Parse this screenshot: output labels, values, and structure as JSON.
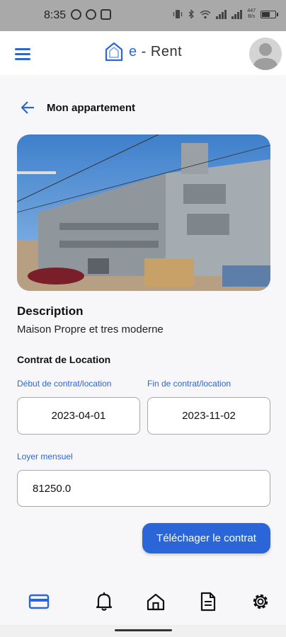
{
  "status": {
    "time": "8:35",
    "net_speed_top": "447",
    "net_speed_bottom": "B/s",
    "battery_level": 0.55
  },
  "app": {
    "brand_prefix": "e",
    "brand_sep": " - ",
    "brand_name": "Rent"
  },
  "page": {
    "title": "Mon appartement"
  },
  "description": {
    "title": "Description",
    "text": "Maison Propre et tres moderne"
  },
  "contract": {
    "title": "Contrat de Location",
    "start_label": "Début de contrat/location",
    "start_value": "2023-04-01",
    "end_label": "Fin de contrat/location",
    "end_value": "2023-11-02",
    "rent_label": "Loyer mensuel",
    "rent_value": "81250.0",
    "download_label": "Téléchager le contrat"
  },
  "colors": {
    "accent": "#2a66d8"
  },
  "nav": [
    {
      "icon": "credit-card-icon",
      "active": true
    },
    {
      "icon": "bell-icon",
      "active": false
    },
    {
      "icon": "home-icon",
      "active": false
    },
    {
      "icon": "document-icon",
      "active": false
    },
    {
      "icon": "settings-icon",
      "active": false
    }
  ]
}
